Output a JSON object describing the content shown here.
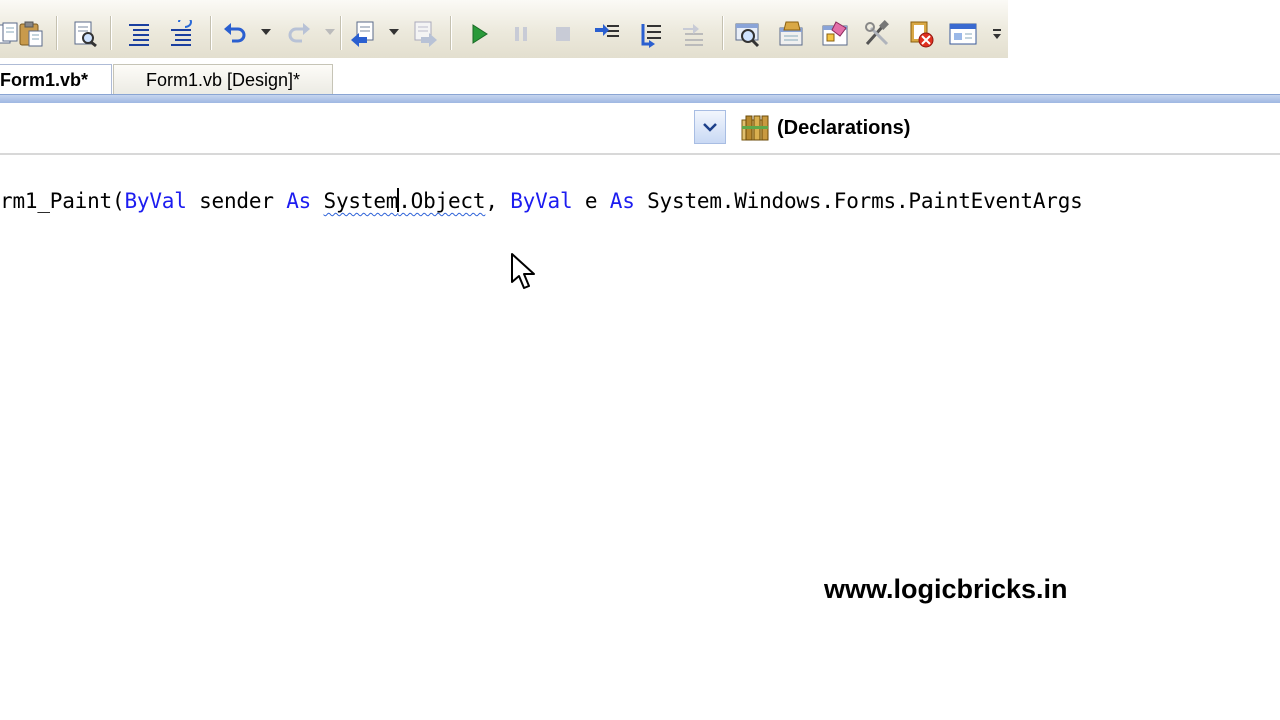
{
  "toolbar": {
    "buttons": [
      {
        "name": "copy-icon"
      },
      {
        "name": "paste-icon"
      },
      {
        "name": "find-icon"
      },
      {
        "name": "comment-lines-icon"
      },
      {
        "name": "uncomment-lines-icon"
      },
      {
        "name": "undo-icon"
      },
      {
        "name": "redo-icon"
      },
      {
        "name": "navigate-backward-icon"
      },
      {
        "name": "navigate-forward-icon"
      },
      {
        "name": "start-debugging-icon"
      },
      {
        "name": "break-all-icon"
      },
      {
        "name": "stop-debugging-icon"
      },
      {
        "name": "step-into-icon"
      },
      {
        "name": "step-over-icon"
      },
      {
        "name": "step-out-icon"
      },
      {
        "name": "solution-explorer-icon"
      },
      {
        "name": "properties-window-icon"
      },
      {
        "name": "object-browser-icon"
      },
      {
        "name": "toolbox-icon"
      },
      {
        "name": "error-list-icon"
      },
      {
        "name": "start-page-icon"
      },
      {
        "name": "toolbar-options-icon"
      }
    ]
  },
  "tabs": [
    {
      "label": "Form1.vb*",
      "active": true
    },
    {
      "label": "Form1.vb [Design]*",
      "active": false
    }
  ],
  "navigation": {
    "class_combo_value": "",
    "member_combo_value": "(Declarations)"
  },
  "code": {
    "t1": "rm1_Paint(",
    "k1": "ByVal",
    "t2": " sender ",
    "k2": "As",
    "t3": " ",
    "sq1": "System",
    "sq2": ".Object",
    "t4": ", ",
    "k3": "ByVal",
    "t5": " e ",
    "k4": "As",
    "t6": " System.Windows.Forms.PaintEventArgs"
  },
  "watermark": "www.logicbricks.in",
  "colors": {
    "keyword": "#1c1cf0",
    "tab_rule": "#9fb7e2",
    "squiggle": "#2e62d8"
  }
}
